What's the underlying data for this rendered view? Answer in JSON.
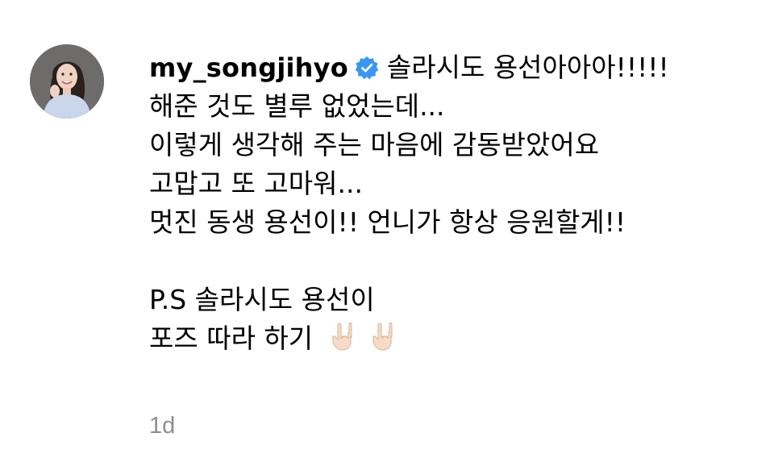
{
  "comment": {
    "username": "my_songjihyo",
    "verified": true,
    "verified_icon": "verified-badge-icon",
    "lines": [
      "솔라시도 용선아아아!!!!!",
      "해준 것도 별루 없었는데...",
      "이렇게 생각해 주는 마음에 감동받았어요",
      "고맙고 또 고마워...",
      "멋진 동생 용선이!! 언니가 항상 응원할게!!",
      "",
      "P.S 솔라시도 용선이",
      "포즈 따라 하기"
    ],
    "emoji": "🤟🏻🤟🏻",
    "emoji_icon": "sign-of-the-horns-hand-icon",
    "timestamp": "1d"
  },
  "colors": {
    "verified_blue": "#3897f0",
    "timestamp_gray": "#8e8e8e",
    "text": "#000000"
  }
}
